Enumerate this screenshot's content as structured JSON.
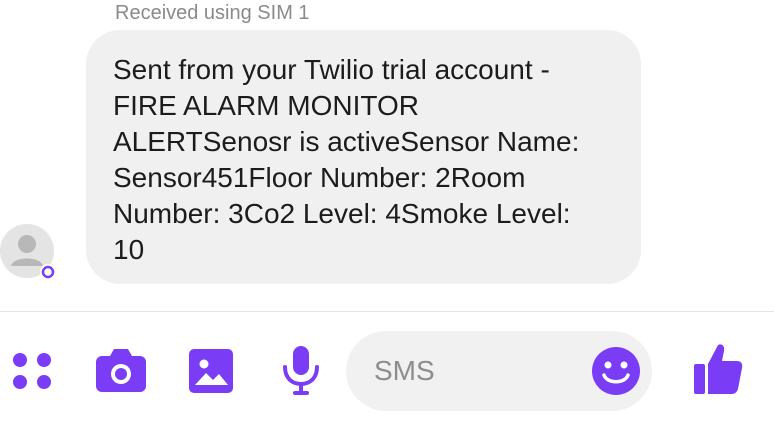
{
  "conversation": {
    "sim_label": "Received using SIM 1",
    "message_lines": [
      "Sent from your Twilio trial account -",
      "FIRE ALARM MONITOR",
      "ALERTSenosr is activeSensor Name:",
      "Sensor451Floor Number: 2Room",
      "Number: 3Co2 Level: 4Smoke Level:",
      "10"
    ]
  },
  "composer": {
    "placeholder": "SMS"
  },
  "icons": {
    "apps": "apps-dots-icon",
    "camera": "camera-icon",
    "gallery": "gallery-image-icon",
    "mic": "microphone-icon",
    "emoji": "emoji-icon",
    "like": "thumbs-up-icon",
    "avatar": "contact-avatar-icon"
  },
  "colors": {
    "accent": "#7a3cf5",
    "bubble": "#f0f0f0",
    "text": "#1c1c1c",
    "muted": "#8a8a8a"
  }
}
